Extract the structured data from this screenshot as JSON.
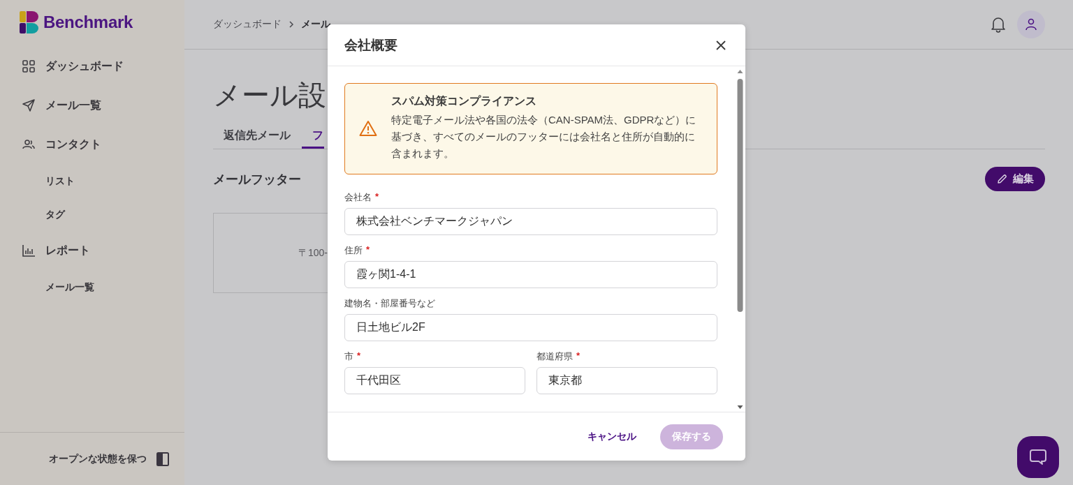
{
  "sidebar": {
    "brand": "Benchmark",
    "items": [
      {
        "label": "ダッシュボード"
      },
      {
        "label": "メール一覧"
      },
      {
        "label": "コンタクト",
        "children": [
          {
            "label": "リスト"
          },
          {
            "label": "タグ"
          }
        ]
      },
      {
        "label": "レポート",
        "children": [
          {
            "label": "メール一覧"
          }
        ]
      }
    ],
    "keep_open_label": "オープンな状態を保つ"
  },
  "main": {
    "breadcrumb": [
      "ダッシュボード",
      "メール"
    ],
    "heading": "メール設",
    "tabs": [
      {
        "label": "返信先メール",
        "selected": false
      },
      {
        "label": "フ",
        "selected": true
      }
    ],
    "section_title": "メールフッター",
    "edit_button": "編集",
    "footer_preview": "〒100-"
  },
  "modal": {
    "title": "会社概要",
    "alert": {
      "title": "スパム対策コンプライアンス",
      "message": "特定電子メール法や各国の法令（CAN-SPAM法、GDPRなど）に基づき、すべてのメールのフッターには会社名と住所が自動的に含まれます。"
    },
    "required_mark": "*",
    "fields": [
      {
        "label": "会社名",
        "required": true,
        "value": "株式会社ベンチマークジャパン",
        "kind": "full"
      },
      {
        "label": "住所",
        "required": true,
        "value": "霞ヶ関1-4-1",
        "kind": "full"
      },
      {
        "label": "建物名・部屋番号など",
        "required": false,
        "value": "日土地ビル2F",
        "kind": "full"
      },
      {
        "label": "市",
        "required": true,
        "value": "千代田区",
        "kind": "half"
      },
      {
        "label": "都道府県",
        "required": true,
        "value": "東京都",
        "kind": "half"
      }
    ],
    "cancel_button": "キャンセル",
    "save_button": {
      "label": "保存する",
      "disabled": true
    }
  }
}
